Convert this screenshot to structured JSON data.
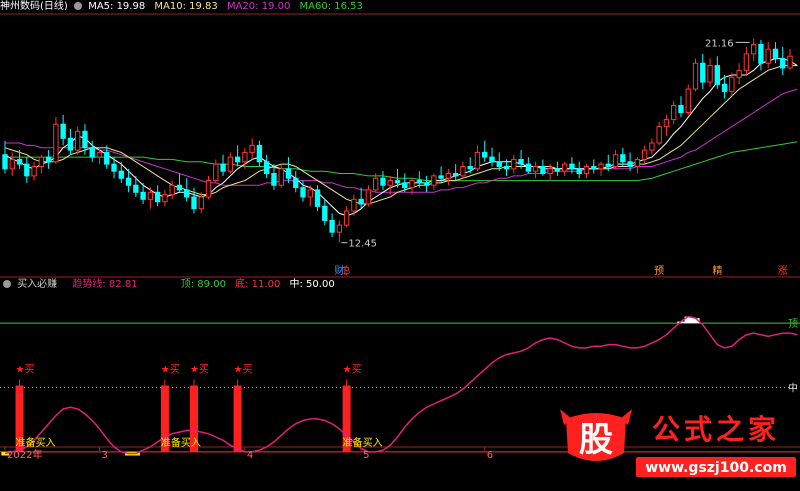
{
  "main_panel": {
    "title": "神州数码(日线)",
    "ma_labels": [
      {
        "text": "MA5: 19.98",
        "color": "#ffffff"
      },
      {
        "text": "MA10: 19.83",
        "color": "#f0e68c"
      },
      {
        "text": "MA20: 19.00",
        "color": "#cc33cc"
      },
      {
        "text": "MA60: 16.53",
        "color": "#33cc33"
      }
    ],
    "high_label": "21.16",
    "low_label": "12.45",
    "event_labels": [
      {
        "text": "财",
        "color": "#3399ff",
        "x_index": 46
      },
      {
        "text": "₿",
        "color": "#ff3333",
        "x_index": 47
      },
      {
        "text": "预",
        "color": "#ff9933",
        "x_index": 90
      },
      {
        "text": "精",
        "color": "#ff9933",
        "x_index": 98
      },
      {
        "text": "涨",
        "color": "#ff3333",
        "x_index": 107
      }
    ]
  },
  "sub_panel": {
    "title": "买入必赚",
    "trend_label": "趋势线: 82.81",
    "top_label": "顶: 89.00",
    "bottom_label": "底: 11.00",
    "mid_label": "中: 50.00",
    "right_top": "顶",
    "right_mid": "中",
    "buy_label": "★买",
    "prepare_label": "准备买入"
  },
  "x_axis": {
    "labels": [
      {
        "text": "2022年",
        "x_index": 0
      },
      {
        "text": "3",
        "x_index": 13
      },
      {
        "text": "4",
        "x_index": 33
      },
      {
        "text": "5",
        "x_index": 49
      },
      {
        "text": "6",
        "x_index": 66
      }
    ]
  },
  "watermark": {
    "glyph": "股",
    "text": "公式之家",
    "url": "www.gszj100.com"
  },
  "colors": {
    "up": "#ff3333",
    "down": "#00ffff",
    "trend": "#e0207a",
    "ma5": "#ffffff",
    "ma10": "#f0e68c",
    "ma20": "#cc33cc",
    "ma60": "#33cc33",
    "top_line": "#33cc33",
    "bottom_line": "#ff3333",
    "buy_bar": "#ff2020",
    "yellow_fill": "#ffee00"
  },
  "chart_data": {
    "type": "candlestick",
    "price_range": [
      11.5,
      22.2
    ],
    "ohlc": [
      [
        16.2,
        16.8,
        15.4,
        15.6
      ],
      [
        15.6,
        16.3,
        15.3,
        16.0
      ],
      [
        16.0,
        16.4,
        15.6,
        15.8
      ],
      [
        15.8,
        16.1,
        15.0,
        15.3
      ],
      [
        15.3,
        15.9,
        15.1,
        15.7
      ],
      [
        15.7,
        16.2,
        15.4,
        16.1
      ],
      [
        16.1,
        16.4,
        15.6,
        15.9
      ],
      [
        15.9,
        17.8,
        15.8,
        17.5
      ],
      [
        17.5,
        17.9,
        16.6,
        16.9
      ],
      [
        16.9,
        17.3,
        16.2,
        16.4
      ],
      [
        16.4,
        17.4,
        16.2,
        17.2
      ],
      [
        17.2,
        17.5,
        16.2,
        16.5
      ],
      [
        16.5,
        16.8,
        15.9,
        16.1
      ],
      [
        16.1,
        16.5,
        15.8,
        16.3
      ],
      [
        16.3,
        16.6,
        15.6,
        15.8
      ],
      [
        15.8,
        16.1,
        15.2,
        15.5
      ],
      [
        15.5,
        15.9,
        15.0,
        15.2
      ],
      [
        15.2,
        15.6,
        14.6,
        14.9
      ],
      [
        14.9,
        15.3,
        14.4,
        14.6
      ],
      [
        14.6,
        15.0,
        14.1,
        14.3
      ],
      [
        14.3,
        14.8,
        13.9,
        14.6
      ],
      [
        14.6,
        14.9,
        14.0,
        14.2
      ],
      [
        14.2,
        14.7,
        14.0,
        14.5
      ],
      [
        14.5,
        15.1,
        14.3,
        14.9
      ],
      [
        14.9,
        15.4,
        14.6,
        14.7
      ],
      [
        14.7,
        15.2,
        14.2,
        14.4
      ],
      [
        14.4,
        14.8,
        13.7,
        13.9
      ],
      [
        13.9,
        14.6,
        13.7,
        14.4
      ],
      [
        14.4,
        15.3,
        14.3,
        15.1
      ],
      [
        15.1,
        16.0,
        15.0,
        15.8
      ],
      [
        15.8,
        16.2,
        15.3,
        15.5
      ],
      [
        15.5,
        16.3,
        15.4,
        16.1
      ],
      [
        16.1,
        16.6,
        15.7,
        15.9
      ],
      [
        15.9,
        16.5,
        15.6,
        16.3
      ],
      [
        16.3,
        16.9,
        16.0,
        16.6
      ],
      [
        16.6,
        16.8,
        15.7,
        15.9
      ],
      [
        15.9,
        16.2,
        15.2,
        15.4
      ],
      [
        15.4,
        15.8,
        14.7,
        14.9
      ],
      [
        14.9,
        15.8,
        14.8,
        15.6
      ],
      [
        15.6,
        16.1,
        15.0,
        15.2
      ],
      [
        15.2,
        15.5,
        14.6,
        14.8
      ],
      [
        14.8,
        15.1,
        14.2,
        14.4
      ],
      [
        14.4,
        14.9,
        14.0,
        14.7
      ],
      [
        14.7,
        14.9,
        13.8,
        14.0
      ],
      [
        14.0,
        14.3,
        13.2,
        13.4
      ],
      [
        13.4,
        13.7,
        12.7,
        12.9
      ],
      [
        12.9,
        13.4,
        12.45,
        13.2
      ],
      [
        13.2,
        14.0,
        13.1,
        13.8
      ],
      [
        13.8,
        14.5,
        13.6,
        14.3
      ],
      [
        14.3,
        14.8,
        13.9,
        14.1
      ],
      [
        14.1,
        14.9,
        14.0,
        14.7
      ],
      [
        14.7,
        15.4,
        14.6,
        15.2
      ],
      [
        15.2,
        15.5,
        14.7,
        14.9
      ],
      [
        14.9,
        15.3,
        14.5,
        15.1
      ],
      [
        15.1,
        15.6,
        14.8,
        15.0
      ],
      [
        15.0,
        15.4,
        14.6,
        14.8
      ],
      [
        14.8,
        15.2,
        14.5,
        15.1
      ],
      [
        15.1,
        15.5,
        14.8,
        15.0
      ],
      [
        15.0,
        15.3,
        14.6,
        14.9
      ],
      [
        14.9,
        15.4,
        14.7,
        15.3
      ],
      [
        15.3,
        15.7,
        15.0,
        15.2
      ],
      [
        15.2,
        15.6,
        14.9,
        15.4
      ],
      [
        15.4,
        15.8,
        15.1,
        15.3
      ],
      [
        15.3,
        15.9,
        15.2,
        15.7
      ],
      [
        15.7,
        16.1,
        15.4,
        15.6
      ],
      [
        15.6,
        16.6,
        15.5,
        16.3
      ],
      [
        16.3,
        16.8,
        15.9,
        16.1
      ],
      [
        16.1,
        16.5,
        15.7,
        15.9
      ],
      [
        15.9,
        16.3,
        15.5,
        15.7
      ],
      [
        15.7,
        16.0,
        15.3,
        15.6
      ],
      [
        15.6,
        16.2,
        15.4,
        16.0
      ],
      [
        16.0,
        16.4,
        15.6,
        15.8
      ],
      [
        15.8,
        16.1,
        15.4,
        15.5
      ],
      [
        15.5,
        15.9,
        15.2,
        15.7
      ],
      [
        15.7,
        16.0,
        15.3,
        15.4
      ],
      [
        15.4,
        15.8,
        15.1,
        15.6
      ],
      [
        15.6,
        15.9,
        15.3,
        15.5
      ],
      [
        15.5,
        15.9,
        15.3,
        15.8
      ],
      [
        15.8,
        16.1,
        15.4,
        15.6
      ],
      [
        15.6,
        15.9,
        15.2,
        15.4
      ],
      [
        15.4,
        15.8,
        15.2,
        15.7
      ],
      [
        15.7,
        16.0,
        15.4,
        15.6
      ],
      [
        15.6,
        15.9,
        15.3,
        15.8
      ],
      [
        15.8,
        16.2,
        15.5,
        15.7
      ],
      [
        15.7,
        16.4,
        15.6,
        16.2
      ],
      [
        16.2,
        16.5,
        15.7,
        15.9
      ],
      [
        15.9,
        16.3,
        15.5,
        15.7
      ],
      [
        15.7,
        16.1,
        15.4,
        16.0
      ],
      [
        16.0,
        16.6,
        15.8,
        16.4
      ],
      [
        16.4,
        16.9,
        16.2,
        16.7
      ],
      [
        16.7,
        17.6,
        16.6,
        17.4
      ],
      [
        17.4,
        17.9,
        17.0,
        17.7
      ],
      [
        17.7,
        18.5,
        17.5,
        18.3
      ],
      [
        18.3,
        18.7,
        17.8,
        18.0
      ],
      [
        18.0,
        19.2,
        17.9,
        19.0
      ],
      [
        19.0,
        20.3,
        18.9,
        20.1
      ],
      [
        20.1,
        20.5,
        19.0,
        19.3
      ],
      [
        19.3,
        20.3,
        19.1,
        20.0
      ],
      [
        20.0,
        20.4,
        19.0,
        19.2
      ],
      [
        19.2,
        19.6,
        18.6,
        18.9
      ],
      [
        18.9,
        19.7,
        18.7,
        19.5
      ],
      [
        19.5,
        20.1,
        19.2,
        19.8
      ],
      [
        19.8,
        20.8,
        19.6,
        20.5
      ],
      [
        20.5,
        21.16,
        20.2,
        20.9
      ],
      [
        20.9,
        21.1,
        19.8,
        20.1
      ],
      [
        20.1,
        21.0,
        19.9,
        20.7
      ],
      [
        20.7,
        21.0,
        20.1,
        20.3
      ],
      [
        20.3,
        20.8,
        19.6,
        19.9
      ],
      [
        19.9,
        20.7,
        19.8,
        20.4
      ]
    ],
    "ma": {
      "MA5": [
        16.2,
        16.0,
        15.9,
        15.7,
        15.6,
        15.8,
        15.9,
        16.1,
        16.5,
        16.7,
        17.0,
        16.9,
        16.6,
        16.4,
        16.2,
        16.0,
        15.8,
        15.5,
        15.2,
        14.9,
        14.7,
        14.5,
        14.4,
        14.5,
        14.6,
        14.6,
        14.5,
        14.4,
        14.5,
        14.8,
        15.0,
        15.3,
        15.6,
        15.8,
        16.0,
        16.1,
        15.9,
        15.7,
        15.6,
        15.4,
        15.2,
        14.9,
        14.8,
        14.6,
        14.3,
        14.0,
        13.7,
        13.6,
        13.7,
        13.9,
        14.2,
        14.4,
        14.6,
        14.8,
        14.9,
        15.0,
        15.0,
        15.0,
        15.0,
        15.1,
        15.1,
        15.2,
        15.3,
        15.4,
        15.5,
        15.7,
        15.8,
        15.9,
        15.9,
        15.9,
        15.9,
        15.8,
        15.7,
        15.7,
        15.6,
        15.6,
        15.6,
        15.6,
        15.6,
        15.6,
        15.6,
        15.6,
        15.6,
        15.7,
        15.8,
        15.8,
        15.8,
        15.9,
        16.0,
        16.1,
        16.4,
        16.7,
        17.1,
        17.4,
        17.8,
        18.2,
        18.6,
        18.9,
        19.3,
        19.5,
        19.6,
        19.6,
        19.6,
        19.8,
        20.1,
        20.2,
        20.3,
        20.3,
        20.2,
        20.0
      ],
      "MA10": [
        16.5,
        16.4,
        16.3,
        16.2,
        16.0,
        15.9,
        15.9,
        15.9,
        16.0,
        16.2,
        16.3,
        16.4,
        16.5,
        16.5,
        16.5,
        16.4,
        16.3,
        16.1,
        15.9,
        15.7,
        15.5,
        15.3,
        15.1,
        14.9,
        14.8,
        14.7,
        14.6,
        14.5,
        14.5,
        14.6,
        14.8,
        14.9,
        15.0,
        15.1,
        15.3,
        15.5,
        15.6,
        15.7,
        15.8,
        15.8,
        15.7,
        15.5,
        15.3,
        15.1,
        14.9,
        14.7,
        14.5,
        14.3,
        14.2,
        14.1,
        14.1,
        14.2,
        14.3,
        14.4,
        14.6,
        14.7,
        14.8,
        14.9,
        14.9,
        15.0,
        15.0,
        15.1,
        15.1,
        15.2,
        15.3,
        15.4,
        15.5,
        15.6,
        15.6,
        15.7,
        15.7,
        15.7,
        15.7,
        15.7,
        15.7,
        15.7,
        15.6,
        15.6,
        15.6,
        15.6,
        15.6,
        15.6,
        15.6,
        15.6,
        15.7,
        15.7,
        15.7,
        15.8,
        15.8,
        15.9,
        16.0,
        16.2,
        16.4,
        16.6,
        16.9,
        17.2,
        17.5,
        17.8,
        18.1,
        18.4,
        18.7,
        19.0,
        19.2,
        19.4,
        19.6,
        19.8,
        19.9,
        20.0,
        20.0,
        20.0
      ],
      "MA20": [
        16.7,
        16.7,
        16.7,
        16.6,
        16.6,
        16.5,
        16.5,
        16.5,
        16.5,
        16.5,
        16.5,
        16.5,
        16.5,
        16.4,
        16.4,
        16.3,
        16.2,
        16.1,
        16.0,
        15.9,
        15.8,
        15.7,
        15.6,
        15.5,
        15.4,
        15.3,
        15.2,
        15.1,
        15.0,
        15.0,
        14.9,
        14.9,
        14.9,
        14.9,
        14.9,
        14.9,
        15.0,
        15.0,
        15.1,
        15.1,
        15.1,
        15.1,
        15.1,
        15.1,
        15.0,
        15.0,
        14.9,
        14.8,
        14.8,
        14.7,
        14.7,
        14.6,
        14.6,
        14.6,
        14.6,
        14.6,
        14.6,
        14.6,
        14.6,
        14.6,
        14.7,
        14.7,
        14.8,
        14.8,
        14.9,
        15.0,
        15.0,
        15.1,
        15.2,
        15.2,
        15.3,
        15.3,
        15.4,
        15.4,
        15.4,
        15.5,
        15.5,
        15.5,
        15.5,
        15.5,
        15.6,
        15.6,
        15.6,
        15.6,
        15.6,
        15.6,
        15.6,
        15.7,
        15.7,
        15.7,
        15.8,
        15.9,
        16.0,
        16.1,
        16.3,
        16.4,
        16.6,
        16.8,
        17.0,
        17.2,
        17.4,
        17.6,
        17.8,
        18.0,
        18.2,
        18.4,
        18.6,
        18.8,
        18.9,
        19.0
      ],
      "MA60": [
        16.1,
        16.1,
        16.1,
        16.1,
        16.1,
        16.1,
        16.1,
        16.1,
        16.1,
        16.1,
        16.1,
        16.1,
        16.1,
        16.1,
        16.1,
        16.1,
        16.1,
        16.1,
        16.1,
        16.1,
        16.05,
        16.0,
        16.0,
        16.0,
        15.95,
        15.9,
        15.9,
        15.9,
        15.85,
        15.8,
        15.8,
        15.8,
        15.75,
        15.7,
        15.7,
        15.7,
        15.7,
        15.65,
        15.6,
        15.6,
        15.6,
        15.55,
        15.5,
        15.5,
        15.5,
        15.45,
        15.4,
        15.4,
        15.4,
        15.35,
        15.3,
        15.3,
        15.3,
        15.25,
        15.2,
        15.2,
        15.2,
        15.15,
        15.1,
        15.1,
        15.1,
        15.1,
        15.1,
        15.1,
        15.1,
        15.1,
        15.1,
        15.1,
        15.1,
        15.1,
        15.1,
        15.1,
        15.1,
        15.1,
        15.1,
        15.1,
        15.1,
        15.1,
        15.1,
        15.1,
        15.1,
        15.1,
        15.1,
        15.1,
        15.1,
        15.1,
        15.1,
        15.1,
        15.15,
        15.2,
        15.3,
        15.4,
        15.5,
        15.6,
        15.7,
        15.8,
        15.9,
        16.0,
        16.1,
        16.2,
        16.3,
        16.35,
        16.4,
        16.45,
        16.5,
        16.55,
        16.6,
        16.65,
        16.7,
        16.75
      ]
    },
    "trend_line": [
      10,
      11,
      12,
      14,
      18,
      23,
      28,
      33,
      37,
      38,
      37,
      34,
      30,
      25,
      19,
      14,
      11,
      10,
      10,
      12,
      14,
      17,
      20,
      22,
      23,
      24,
      24,
      23,
      22,
      20,
      18,
      15,
      13,
      11,
      11,
      12,
      14,
      17,
      21,
      25,
      28,
      30,
      31,
      31,
      30,
      28,
      25,
      21,
      17,
      13,
      11,
      11,
      12,
      15,
      20,
      26,
      31,
      35,
      38,
      40,
      42,
      44,
      46,
      49,
      53,
      57,
      61,
      65,
      68,
      70,
      71,
      72,
      74,
      77,
      79,
      80,
      79,
      77,
      75,
      74,
      74,
      75,
      75,
      76,
      76,
      75,
      74,
      74,
      75,
      77,
      79,
      82,
      86,
      90,
      93,
      92,
      88,
      82,
      76,
      74,
      75,
      79,
      82,
      83,
      82,
      81,
      82,
      83,
      83,
      82
    ],
    "trend_range": [
      0,
      100
    ],
    "buy_signals": [
      2,
      22,
      26,
      32,
      47
    ],
    "prepare_buy_indices": [
      2,
      22,
      47
    ]
  }
}
